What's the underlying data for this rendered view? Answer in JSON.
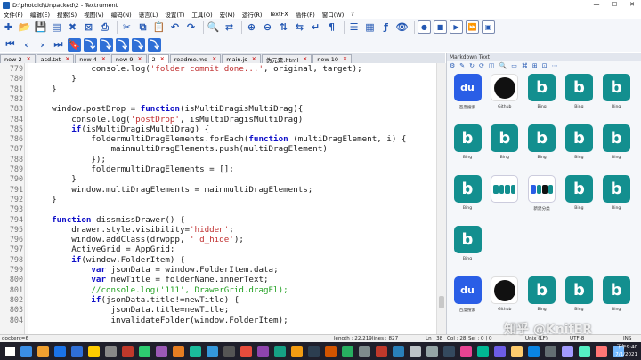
{
  "window": {
    "title": "D:\\photoid\\Unpacked\\2 - Textrument",
    "minimize": "—",
    "maximize": "☐",
    "close": "✕"
  },
  "menu": [
    "文件(F)",
    "编辑(E)",
    "搜索(S)",
    "视图(V)",
    "编码(N)",
    "语言(L)",
    "设置(T)",
    "工具(O)",
    "宏(M)",
    "运行(R)",
    "TextFX",
    "插件(P)",
    "窗口(W)",
    "?"
  ],
  "toolbar1": [
    "new-file",
    "open",
    "save",
    "save-all",
    "close",
    "close-all",
    "print",
    "cut",
    "copy",
    "paste",
    "undo",
    "redo",
    "find",
    "replace",
    "zoom-in",
    "zoom-out",
    "sync-v",
    "sync-h",
    "word-wrap",
    "all-chars",
    "indent-guide",
    "doc-map",
    "function-list",
    "monitor",
    "record",
    "stop",
    "play",
    "run-multi",
    "save-macro"
  ],
  "toolbar2": [
    "first",
    "prev",
    "next",
    "last",
    "bookmark",
    "jump"
  ],
  "tabs": [
    {
      "label": "new 2",
      "active": false
    },
    {
      "label": "asd.txt",
      "active": false
    },
    {
      "label": "new 4",
      "active": false
    },
    {
      "label": "new 9",
      "active": false
    },
    {
      "label": "2",
      "active": true
    },
    {
      "label": "readme.md",
      "active": false
    },
    {
      "label": "main.js",
      "active": false
    },
    {
      "label": "伪元素.html",
      "active": false
    },
    {
      "label": "new 10",
      "active": false
    }
  ],
  "code": [
    {
      "n": "779",
      "t": [
        [
          "",
          "            console.log("
        ],
        [
          "str",
          "'folder commit done...'"
        ],
        [
          "",
          ", original, target);"
        ]
      ]
    },
    {
      "n": "780",
      "t": [
        [
          "",
          "        }"
        ]
      ]
    },
    {
      "n": "781",
      "t": [
        [
          "",
          "    }"
        ]
      ]
    },
    {
      "n": "782",
      "t": [
        [
          "",
          ""
        ]
      ]
    },
    {
      "n": "783",
      "t": [
        [
          "",
          "    window.postDrop = "
        ],
        [
          "kw",
          "function"
        ],
        [
          "",
          "(isMultiDragisMultiDrag){"
        ]
      ]
    },
    {
      "n": "784",
      "t": [
        [
          "",
          "        console.log("
        ],
        [
          "str",
          "'postDrop'"
        ],
        [
          "",
          ", isMultiDragisMultiDrag)"
        ]
      ]
    },
    {
      "n": "785",
      "t": [
        [
          "",
          "        "
        ],
        [
          "kw",
          "if"
        ],
        [
          "",
          "(isMultiDragisMultiDrag) {"
        ]
      ]
    },
    {
      "n": "786",
      "t": [
        [
          "",
          "            foldermultiDragElements.forEach("
        ],
        [
          "kw",
          "function"
        ],
        [
          "",
          " (multiDragElement, i) {"
        ]
      ]
    },
    {
      "n": "787",
      "t": [
        [
          "",
          "                mainmultiDragElements.push(multiDragElement)"
        ]
      ]
    },
    {
      "n": "788",
      "t": [
        [
          "",
          "            });"
        ]
      ]
    },
    {
      "n": "789",
      "t": [
        [
          "",
          "            foldermultiDragElements = [];"
        ]
      ]
    },
    {
      "n": "790",
      "t": [
        [
          "",
          "        }"
        ]
      ]
    },
    {
      "n": "791",
      "t": [
        [
          "",
          "        window.multiDragElements = mainmultiDragElements;"
        ]
      ]
    },
    {
      "n": "792",
      "t": [
        [
          "",
          "    }"
        ]
      ]
    },
    {
      "n": "793",
      "t": [
        [
          "",
          ""
        ]
      ]
    },
    {
      "n": "794",
      "t": [
        [
          "",
          "    "
        ],
        [
          "kw",
          "function"
        ],
        [
          "",
          " dissmissDrawer() {"
        ]
      ]
    },
    {
      "n": "795",
      "t": [
        [
          "",
          "        drawer.style.visibility="
        ],
        [
          "str",
          "'hidden'"
        ],
        [
          "",
          ";"
        ]
      ]
    },
    {
      "n": "796",
      "t": [
        [
          "",
          "        window.addClass(drwppp, "
        ],
        [
          "str",
          "' d_hide'"
        ],
        [
          "",
          ");"
        ]
      ]
    },
    {
      "n": "797",
      "t": [
        [
          "",
          "        ActiveGrid = AppGrid;"
        ]
      ]
    },
    {
      "n": "798",
      "t": [
        [
          "",
          "        "
        ],
        [
          "kw",
          "if"
        ],
        [
          "",
          "(window.FolderItem) {"
        ]
      ]
    },
    {
      "n": "799",
      "t": [
        [
          "",
          "            "
        ],
        [
          "kw",
          "var"
        ],
        [
          "",
          " jsonData = window.FolderItem.data;"
        ]
      ]
    },
    {
      "n": "800",
      "t": [
        [
          "",
          "            "
        ],
        [
          "kw",
          "var"
        ],
        [
          "",
          " newTitle = folderName.innerText;"
        ]
      ]
    },
    {
      "n": "801",
      "t": [
        [
          "",
          "            "
        ],
        [
          "cm",
          "//console.log('111', DrawerGrid.dragEl);"
        ]
      ]
    },
    {
      "n": "802",
      "t": [
        [
          "",
          "            "
        ],
        [
          "kw",
          "if"
        ],
        [
          "",
          "(jsonData.title!=newTitle) {"
        ]
      ]
    },
    {
      "n": "803",
      "t": [
        [
          "",
          "                jsonData.title=newTitle;"
        ]
      ]
    },
    {
      "n": "804",
      "t": [
        [
          "",
          "                invalidateFolder(window.FolderItem);"
        ]
      ]
    }
  ],
  "panel": {
    "title": "Markdown Text",
    "tools": [
      "⚙",
      "✎",
      "↻",
      "⟳",
      "◫",
      "🔍",
      "▭",
      "⌘",
      "⊞",
      "⊡",
      "⋯"
    ]
  },
  "grid_items": [
    {
      "label": "百度搜索",
      "kind": "baidu",
      "icon_text": "du"
    },
    {
      "label": "Github",
      "kind": "github"
    },
    {
      "label": "Bing",
      "kind": "bing",
      "icon_text": "b"
    },
    {
      "label": "Bing",
      "kind": "bing",
      "icon_text": "b"
    },
    {
      "label": "Bing",
      "kind": "bing",
      "icon_text": "b"
    },
    {
      "label": "Bing",
      "kind": "bing",
      "icon_text": "b"
    },
    {
      "label": "Bing",
      "kind": "bing",
      "icon_text": "b"
    },
    {
      "label": "Bing",
      "kind": "bing",
      "icon_text": "b"
    },
    {
      "label": "Bing",
      "kind": "bing",
      "icon_text": "b"
    },
    {
      "label": "Bing",
      "kind": "bing",
      "icon_text": "b"
    },
    {
      "label": "Bing",
      "kind": "bing",
      "icon_text": "b"
    },
    {
      "label": "Bing",
      "kind": "folder"
    },
    {
      "label": "新建分类",
      "kind": "folder2"
    },
    {
      "label": "Bing",
      "kind": "bing",
      "icon_text": "b"
    },
    {
      "label": "Bing",
      "kind": "bing",
      "icon_text": "b"
    },
    {
      "label": "Bing",
      "kind": "bing",
      "icon_text": "b"
    },
    {
      "label": "百度搜索",
      "kind": "baidu",
      "icon_text": "du"
    },
    {
      "label": "Github",
      "kind": "github"
    },
    {
      "label": "Bing",
      "kind": "bing",
      "icon_text": "b"
    },
    {
      "label": "Bing",
      "kind": "bing",
      "icon_text": "b"
    },
    {
      "label": "Bing",
      "kind": "bing",
      "icon_text": "b"
    }
  ],
  "status": {
    "left": "dockerc=6",
    "length": "length : 22,219",
    "lines": "lines : 827",
    "ln": "Ln : 38",
    "col": "Col : 28",
    "sel": "Sel : 0 | 0",
    "eol": "Unix (LF)",
    "enc": "UTF-8",
    "mode": "INS"
  },
  "clock": {
    "time": "下午9:40",
    "date": "7/1/2021"
  },
  "watermark": "知乎 @KnifER",
  "colors": {
    "bing": "#138f8f",
    "baidu": "#2a5ee6",
    "keyword": "#1010c8",
    "string": "#c03030",
    "comment": "#1e9e1e"
  }
}
